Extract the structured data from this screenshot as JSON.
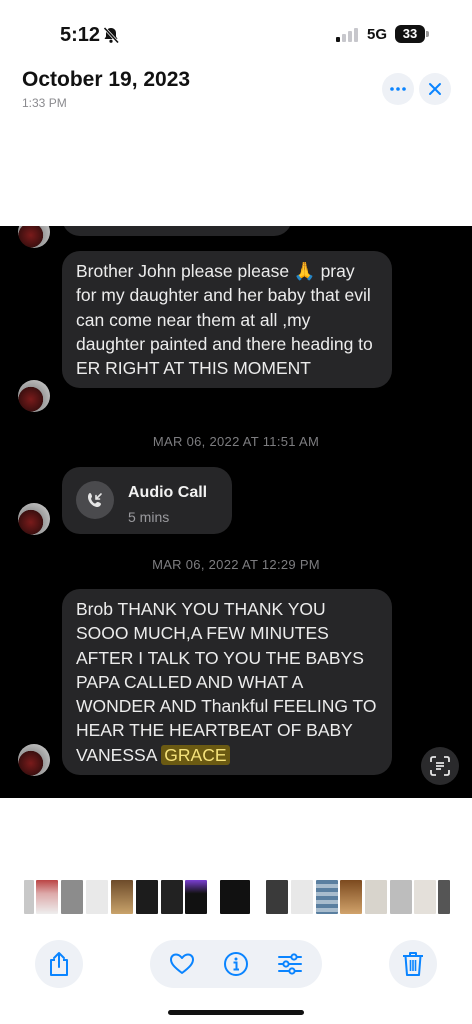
{
  "status_bar": {
    "time": "5:12",
    "network": "5G",
    "battery": "33"
  },
  "header": {
    "title": "October 19, 2023",
    "subtitle": "1:33 PM"
  },
  "chat": {
    "message1": "Brother John please please 🙏 pray for my daughter and her baby that evil can come near them at all ,my daughter painted and there heading to ER RIGHT AT THIS MOMENT",
    "timestamp1": "MAR 06, 2022 AT 11:51 AM",
    "call_title": "Audio Call",
    "call_duration": "5 mins",
    "timestamp2": "MAR 06, 2022 AT 12:29 PM",
    "message2_main": "Brob THANK YOU THANK YOU SOOO MUCH,A FEW MINUTES AFTER I TALK TO YOU THE BABYS PAPA CALLED AND WHAT A WONDER AND Thankful FEELING TO HEAR THE HEARTBEAT OF BABY  VANESSA",
    "message2_highlight": "GRACE"
  },
  "colors": {
    "accent": "#0a84ff",
    "highlight": "#6b5a12"
  }
}
